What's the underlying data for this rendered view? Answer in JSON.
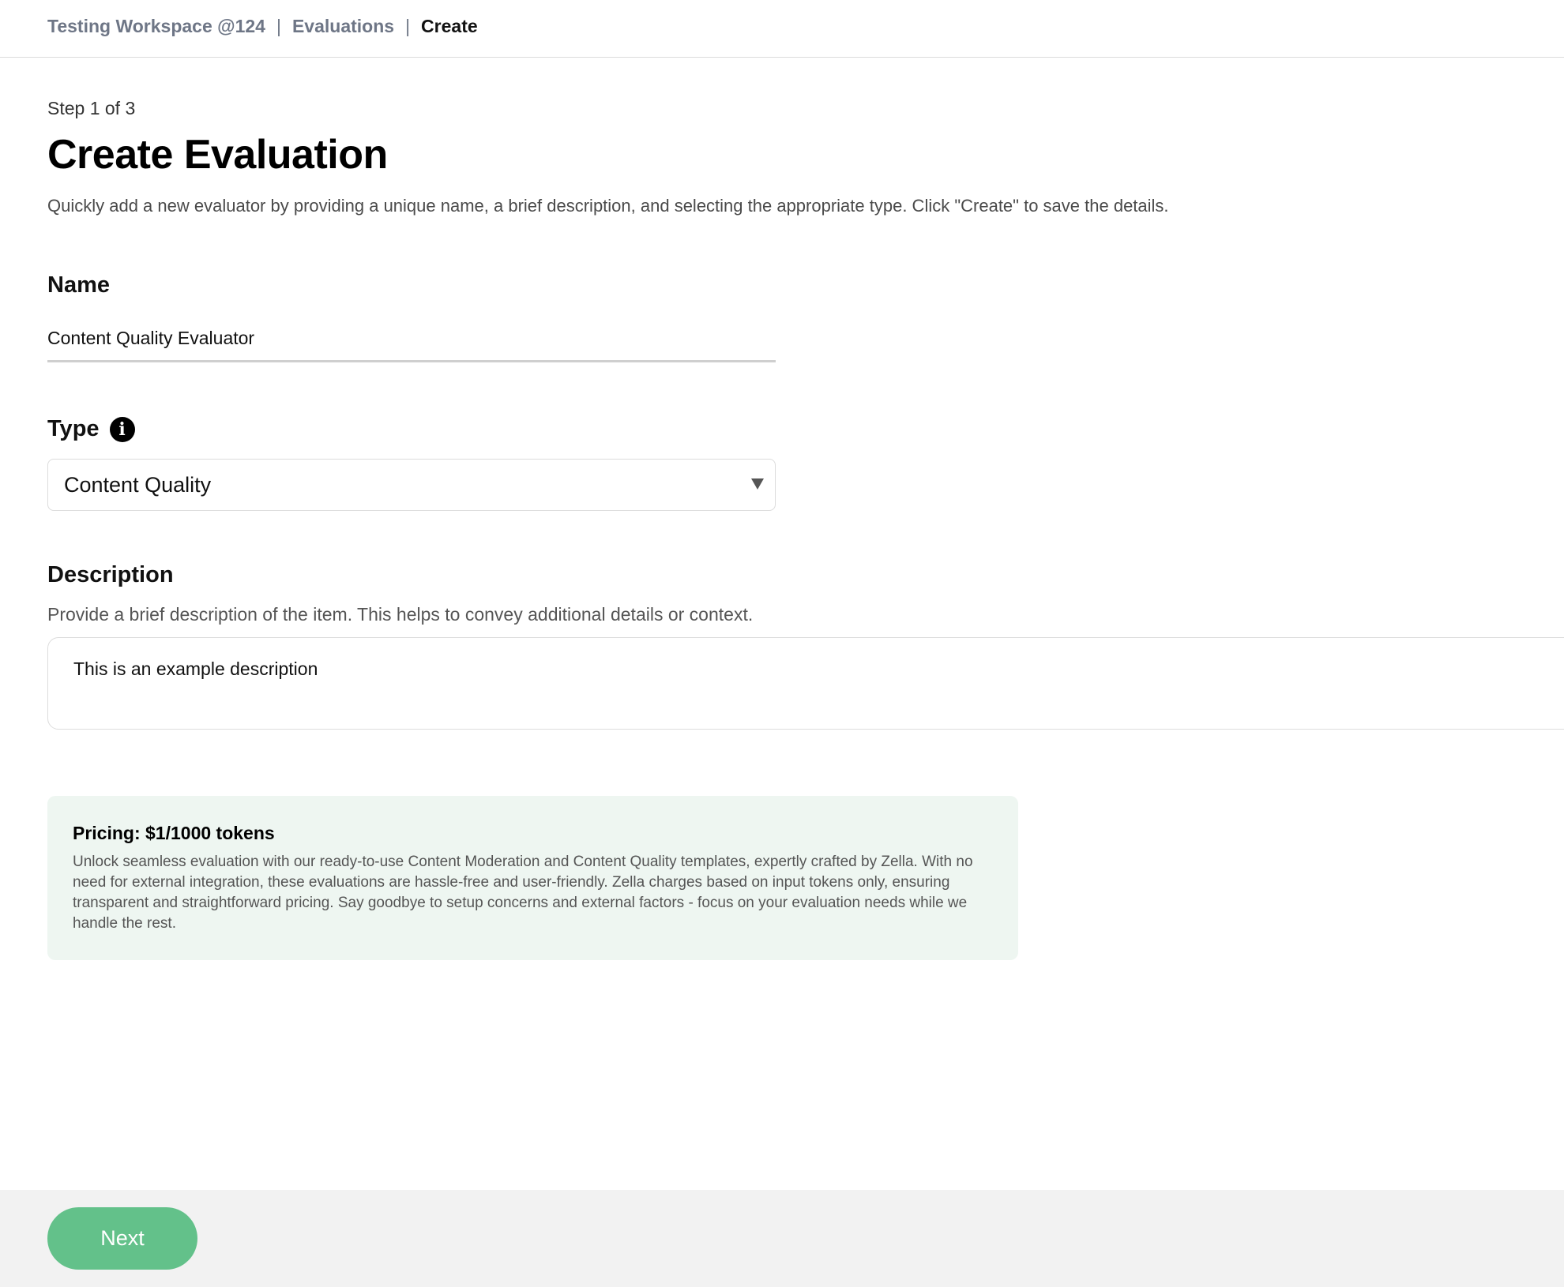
{
  "breadcrumb": {
    "items": [
      "Testing Workspace @124",
      "Evaluations",
      "Create"
    ],
    "separator": "|"
  },
  "step_text": "Step 1 of 3",
  "page_title": "Create Evaluation",
  "subtitle": "Quickly add a new evaluator by providing a unique name, a brief description, and selecting the appropriate type. Click \"Create\" to save the details.",
  "form": {
    "name": {
      "label": "Name",
      "value": "Content Quality Evaluator"
    },
    "type": {
      "label": "Type",
      "info_icon": "i",
      "selected": "Content Quality"
    },
    "description": {
      "label": "Description",
      "help": "Provide a brief description of the item. This helps to convey additional details or context.",
      "value": "This is an example description"
    }
  },
  "pricing": {
    "title": "Pricing: $1/1000 tokens",
    "body": "Unlock seamless evaluation with our ready-to-use Content Moderation and Content Quality templates, expertly crafted by Zella. With no need for external integration, these evaluations are hassle-free and user-friendly. Zella charges based on input tokens only, ensuring transparent and straightforward pricing. Say goodbye to setup concerns and external factors - focus on your evaluation needs while we handle the rest."
  },
  "footer": {
    "next_label": "Next"
  },
  "colors": {
    "accent": "#63c18a",
    "pricing_bg": "#eef6f1",
    "footer_bg": "#f2f2f2",
    "breadcrumb_muted": "#6e7686"
  }
}
